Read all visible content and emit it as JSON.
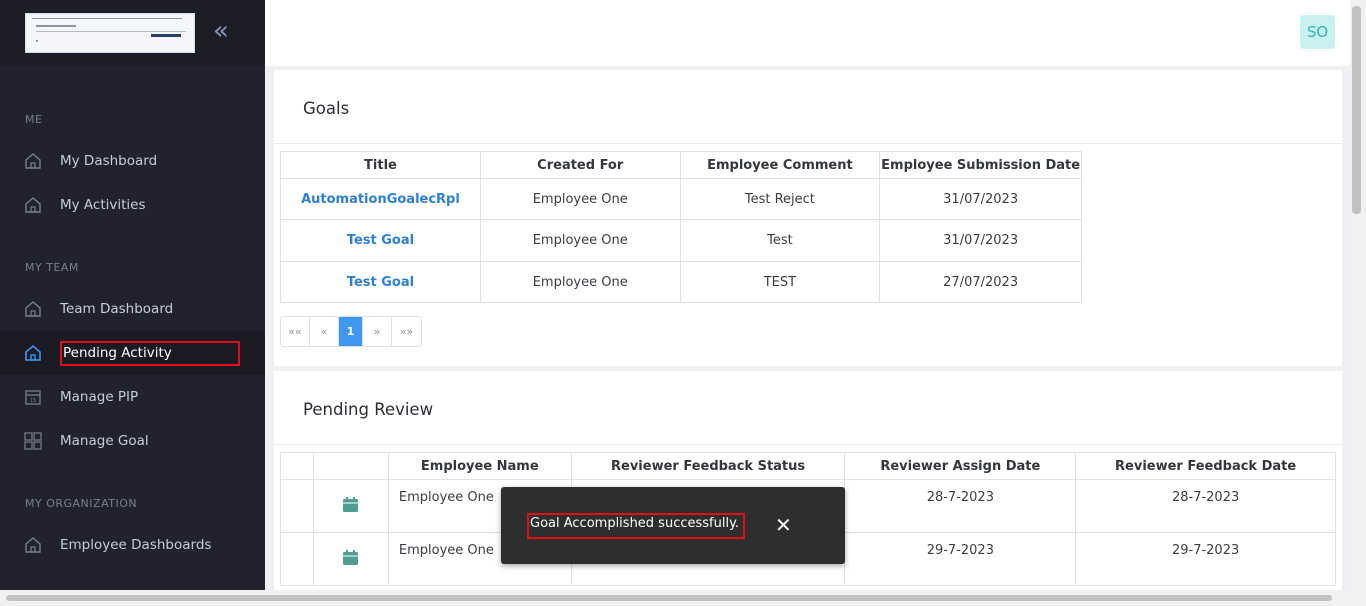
{
  "sidebar": {
    "sections": {
      "me": "ME",
      "my_team": "MY TEAM",
      "my_org": "MY ORGANIZATION"
    },
    "items": [
      {
        "label": "My Dashboard",
        "icon": "home-icon"
      },
      {
        "label": "My Activities",
        "icon": "home-icon"
      },
      {
        "label": "Team Dashboard",
        "icon": "home-icon"
      },
      {
        "label": "Pending Activity",
        "icon": "home-icon",
        "active": true
      },
      {
        "label": "Manage PIP",
        "icon": "calendar-icon"
      },
      {
        "label": "Manage Goal",
        "icon": "grid-icon"
      },
      {
        "label": "Employee Dashboards",
        "icon": "home-icon"
      }
    ],
    "collapse_icon": "«"
  },
  "header": {
    "avatar_initials": "SO"
  },
  "goals": {
    "title": "Goals",
    "columns": [
      "Title",
      "Created For",
      "Employee Comment",
      "Employee Submission Date"
    ],
    "rows": [
      [
        "AutomationGoalecRpl",
        "Employee One",
        "Test Reject",
        "31/07/2023"
      ],
      [
        "Test Goal",
        "Employee One",
        "Test",
        "31/07/2023"
      ],
      [
        "Test Goal",
        "Employee One",
        "TEST",
        "27/07/2023"
      ]
    ],
    "pager": [
      "««",
      "«",
      "1",
      "»",
      "»»"
    ]
  },
  "pending_review": {
    "title": "Pending Review",
    "columns": [
      "",
      "",
      "Employee Name",
      "Reviewer Feedback Status",
      "Reviewer Assign Date",
      "Reviewer Feedback Date"
    ],
    "rows": [
      [
        "",
        "calendar-icon",
        "Employee One",
        "",
        "28-7-2023",
        "28-7-2023"
      ],
      [
        "",
        "calendar-icon",
        "Employee One",
        "",
        "29-7-2023",
        "29-7-2023"
      ]
    ]
  },
  "toast": {
    "message": "Goal Accomplished successfully.",
    "close": "✕"
  },
  "colors": {
    "sidebar_bg": "#22222e",
    "accent": "#3f97f0",
    "link": "#2f7fd6",
    "highlight": "#e0101a",
    "toast_bg": "#2e2e2e"
  }
}
